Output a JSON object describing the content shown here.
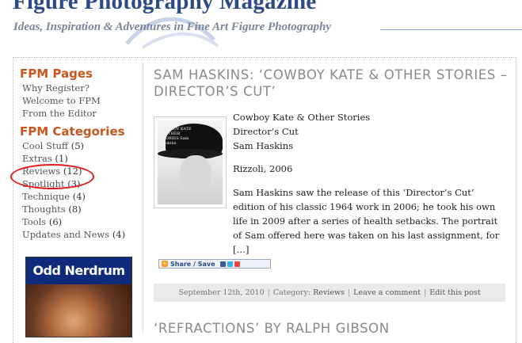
{
  "header": {
    "site_title": "Figure Photography Magazine",
    "tagline": "Ideas, Inspiration & Adventures in Fine Art Figure Photography"
  },
  "sidebar": {
    "pages_heading": "FPM Pages",
    "pages": [
      {
        "label": "Why Register?"
      },
      {
        "label": "Welcome to FPM"
      },
      {
        "label": "From the Editor"
      }
    ],
    "categories_heading": "FPM Categories",
    "categories": [
      {
        "label": "Cool Stuff",
        "count": "(5)"
      },
      {
        "label": "Extras",
        "count": "(1)"
      },
      {
        "label": "Reviews",
        "count": "(12)"
      },
      {
        "label": "Spotlight",
        "count": "(3)"
      },
      {
        "label": "Technique",
        "count": "(4)"
      },
      {
        "label": "Thoughts",
        "count": "(8)"
      },
      {
        "label": "Tools",
        "count": "(6)"
      },
      {
        "label": "Updates and News",
        "count": "(4)"
      }
    ],
    "ad_title": "Odd Nerdrum"
  },
  "post": {
    "title": "SAM HASKINS: ‘COWBOY KATE & OTHER STORIES – DIRECTOR’S CUT’",
    "book_title": "Cowboy Kate & Other Stories",
    "edition": "Director’s Cut",
    "author": "Sam Haskins",
    "publisher": "Rizzoli, 2006",
    "excerpt": "Sam Haskins saw the release of this ‘Director’s Cut’ edition of his classic 1964 work in 2006; he took his own life in 2009 after a series of health setbacks. The portrait of Sam offered here was taken on his last assignment, for […]",
    "thumb_text": "COWBOY KATE & OTHER STORIES Sam Haskins",
    "share_label": "Share / Save",
    "footer": {
      "date": "September 12th, 2010",
      "category_prefix": "Category:",
      "category": "Reviews",
      "comment_link": "Leave a comment",
      "edit_link": "Edit this post"
    }
  },
  "next_post": {
    "title": "‘REFRACTIONS’ BY RALPH GIBSON"
  },
  "colors": {
    "title_blue": "#2c4a86",
    "sidebar_heading": "#c8561e",
    "annotation_red": "#e21b1b",
    "footer_bg": "#eaeaea"
  }
}
